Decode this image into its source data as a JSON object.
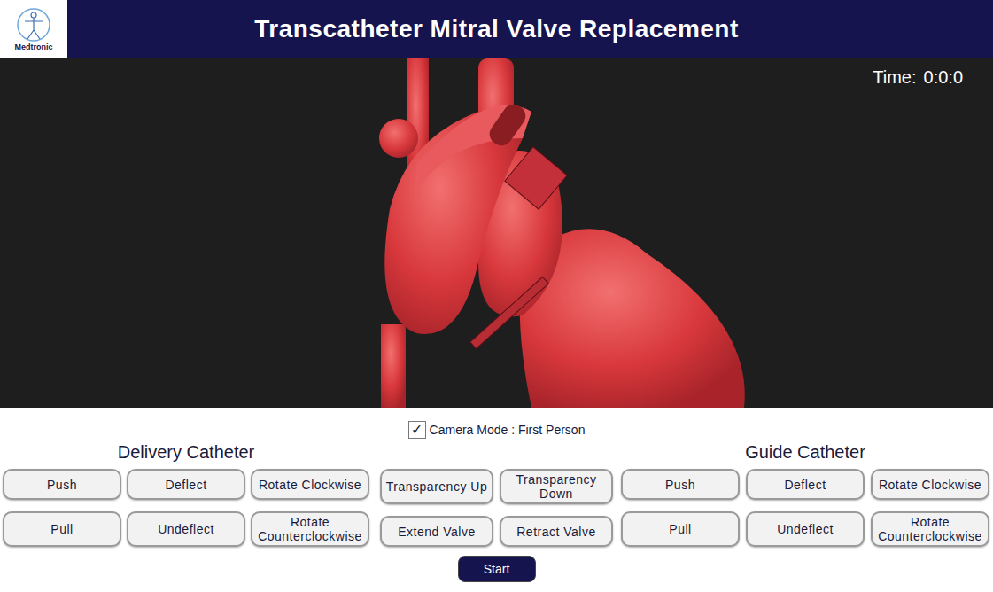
{
  "header": {
    "title": "Transcatheter Mitral Valve Replacement",
    "logo_text": "Medtronic"
  },
  "viewport": {
    "time_label": "Time:",
    "time_value": "0:0:0"
  },
  "camera_mode": {
    "label": "Camera Mode : First Person",
    "checked": true,
    "check_mark": "✓"
  },
  "delivery_catheter": {
    "title": "Delivery Catheter",
    "buttons": [
      [
        "Push",
        "Deflect",
        "Rotate Clockwise"
      ],
      [
        "Pull",
        "Undeflect",
        "Rotate Counterclockwise"
      ]
    ]
  },
  "valve_controls": {
    "buttons": [
      [
        "Transparency Up",
        "Transparency Down"
      ],
      [
        "Extend Valve",
        "Retract Valve"
      ]
    ]
  },
  "guide_catheter": {
    "title": "Guide Catheter",
    "buttons": [
      [
        "Push",
        "Deflect",
        "Rotate Clockwise"
      ],
      [
        "Pull",
        "Undeflect",
        "Rotate Counterclockwise"
      ]
    ]
  },
  "start_button": "Start"
}
